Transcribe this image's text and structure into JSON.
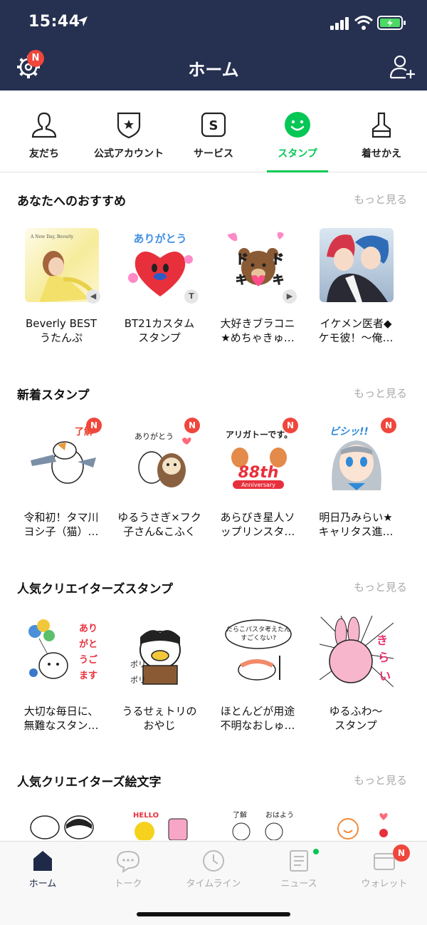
{
  "status_bar": {
    "time": "15:44"
  },
  "header": {
    "title": "ホーム",
    "settings_badge": "N"
  },
  "tabs": [
    {
      "label": "友だち",
      "icon": "person-icon"
    },
    {
      "label": "公式アカウント",
      "icon": "official-shield-icon"
    },
    {
      "label": "サービス",
      "icon": "service-s-icon"
    },
    {
      "label": "スタンプ",
      "icon": "smile-icon",
      "active": true
    },
    {
      "label": "着せかえ",
      "icon": "brush-icon"
    }
  ],
  "sections": [
    {
      "title": "あなたへのおすすめ",
      "more": "もっと見る",
      "items": [
        {
          "name": "Beverly BEST\nうたんぷ",
          "thumb_text": "A New Day, Beverly"
        },
        {
          "name": "BT21カスタム\nスタンプ",
          "thumb_text": "ありがとう"
        },
        {
          "name": "大好きブラコニ\n★めちゃきゅ…",
          "thumb_text": "ドキドキ"
        },
        {
          "name": "イケメン医者◆\nケモ彼！～俺…",
          "thumb_text": ""
        }
      ]
    },
    {
      "title": "新着スタンプ",
      "more": "もっと見る",
      "badge": "N",
      "items": [
        {
          "name": "令和初！タマ川\nヨシ子（猫）…",
          "thumb_text": "了解"
        },
        {
          "name": "ゆるうさぎ×フク\n子さん&こふく",
          "thumb_text": "ありがとう"
        },
        {
          "name": "あらびき星人ソ\nップリンスタ…",
          "thumb_text": "アリガトーです。"
        },
        {
          "name": "明日乃みらい★\nキャリタス進…",
          "thumb_text": "ビシッ!!"
        }
      ]
    },
    {
      "title": "人気クリエイターズスタンプ",
      "more": "もっと見る",
      "items": [
        {
          "name": "大切な毎日に、\n無難なスタン…",
          "thumb_text": "ありがとうございます"
        },
        {
          "name": "うるせぇトリの\nおやじ",
          "thumb_text": "ポリポリ"
        },
        {
          "name": "ほとんどが用途\n不明なおしゅ…",
          "thumb_text": "たらこパスタ考えたんすごくない?"
        },
        {
          "name": "ゆるふわ～\nスタンプ",
          "thumb_text": "きらい!!"
        }
      ]
    },
    {
      "title": "人気クリエイターズ絵文字",
      "more": "もっと見る",
      "items": [
        {
          "name": "",
          "thumb_text": ""
        },
        {
          "name": "",
          "thumb_text": "HELLO"
        },
        {
          "name": "",
          "thumb_text": "了解 おはよう"
        },
        {
          "name": "",
          "thumb_text": ""
        }
      ]
    }
  ],
  "bottom_nav": [
    {
      "label": "ホーム",
      "icon": "home-icon",
      "active": true
    },
    {
      "label": "トーク",
      "icon": "chat-icon"
    },
    {
      "label": "タイムライン",
      "icon": "clock-icon"
    },
    {
      "label": "ニュース",
      "icon": "news-icon",
      "dot": true
    },
    {
      "label": "ウォレット",
      "icon": "wallet-icon",
      "badge": "N"
    }
  ],
  "colors": {
    "header_bg": "#263050",
    "accent_green": "#06c755",
    "badge_red": "#f0463c"
  }
}
